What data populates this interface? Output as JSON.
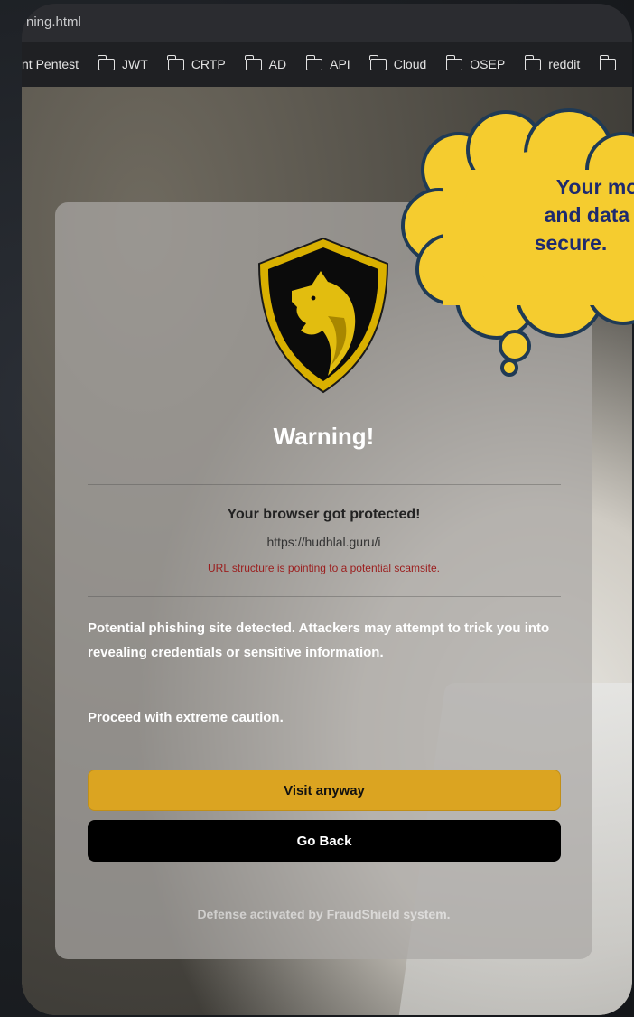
{
  "browser": {
    "tab_title": "rning.html",
    "bookmarks": [
      "nt Pentest",
      "JWT",
      "CRTP",
      "AD",
      "API",
      "Cloud",
      "OSEP",
      "reddit",
      ""
    ]
  },
  "warning_card": {
    "title": "Warning!",
    "subtitle": "Your browser got protected!",
    "url": "https://hudhlal.guru/i",
    "url_warning": "URL structure is pointing to a potential scamsite.",
    "description": "Potential phishing site detected. Attackers may attempt to trick you into revealing credentials or sensitive information.",
    "caution": "Proceed with extreme caution.",
    "visit_button": "Visit anyway",
    "back_button": "Go Back",
    "footer": "Defense activated by FraudShield system."
  },
  "callout": {
    "line1": "Your mone",
    "line2": "and data ar",
    "line3": "secure."
  },
  "colors": {
    "visit_button": "#dba421",
    "back_button": "#000000",
    "url_warning": "#9b1d1d",
    "callout_fill": "#f5cc2f",
    "callout_text": "#1e2a6e"
  },
  "icons": [
    "folder-icon",
    "wolf-shield-logo",
    "thought-cloud"
  ]
}
